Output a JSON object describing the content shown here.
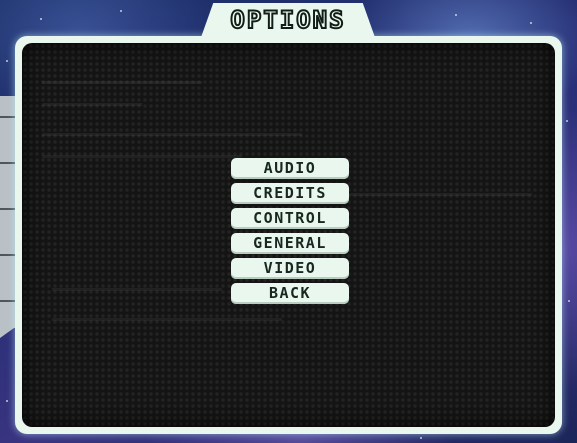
{
  "title": "OPTIONS",
  "menu": {
    "items": [
      {
        "label": "AUDIO"
      },
      {
        "label": "CREDITS"
      },
      {
        "label": "CONTROL"
      },
      {
        "label": "GENERAL"
      },
      {
        "label": "VIDEO"
      },
      {
        "label": "BACK"
      }
    ]
  },
  "colors": {
    "panel_frame": "#eaf7ee",
    "panel_background": "#141414",
    "button_background": "#eaf7ee",
    "button_text": "#16281f",
    "space_background": "#2a2f78"
  }
}
